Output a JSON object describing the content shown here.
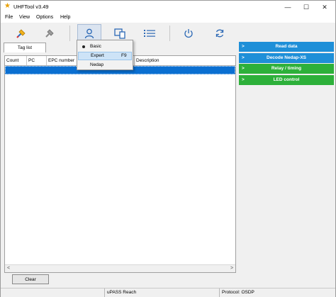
{
  "window": {
    "title": "UHFTool v3.49",
    "controls": [
      "—",
      "☐",
      "✕"
    ]
  },
  "menu": [
    "File",
    "View",
    "Options",
    "Help"
  ],
  "toolbar": {
    "icons": [
      "connect-icon",
      "disconnect-icon",
      "user-icon",
      "devices-icon",
      "list-icon",
      "power-icon",
      "refresh-icon"
    ]
  },
  "tabs": {
    "tag_list": "Tag list"
  },
  "table": {
    "columns": [
      "Count",
      "PC",
      "EPC number",
      "Description"
    ]
  },
  "dropdown": {
    "items": [
      {
        "label": "Basic",
        "shortcut": "",
        "checked": true
      },
      {
        "label": "Expert",
        "shortcut": "F9",
        "checked": false
      },
      {
        "label": "Nedap",
        "shortcut": "",
        "checked": false
      }
    ]
  },
  "buttons": {
    "clear": "Clear"
  },
  "panel": {
    "items": [
      {
        "label": "Read data",
        "color": "#1e8fd8"
      },
      {
        "label": "Decode Nedap-XS",
        "color": "#1e8fd8"
      },
      {
        "label": "Relay / timing",
        "color": "#2db03a"
      },
      {
        "label": "LED control",
        "color": "#2db03a"
      }
    ],
    "arrow": ">"
  },
  "status": {
    "device": "uPASS Reach",
    "protocol": "Protocol: OSDP"
  },
  "scroll": {
    "left": "<",
    "right": ">"
  }
}
